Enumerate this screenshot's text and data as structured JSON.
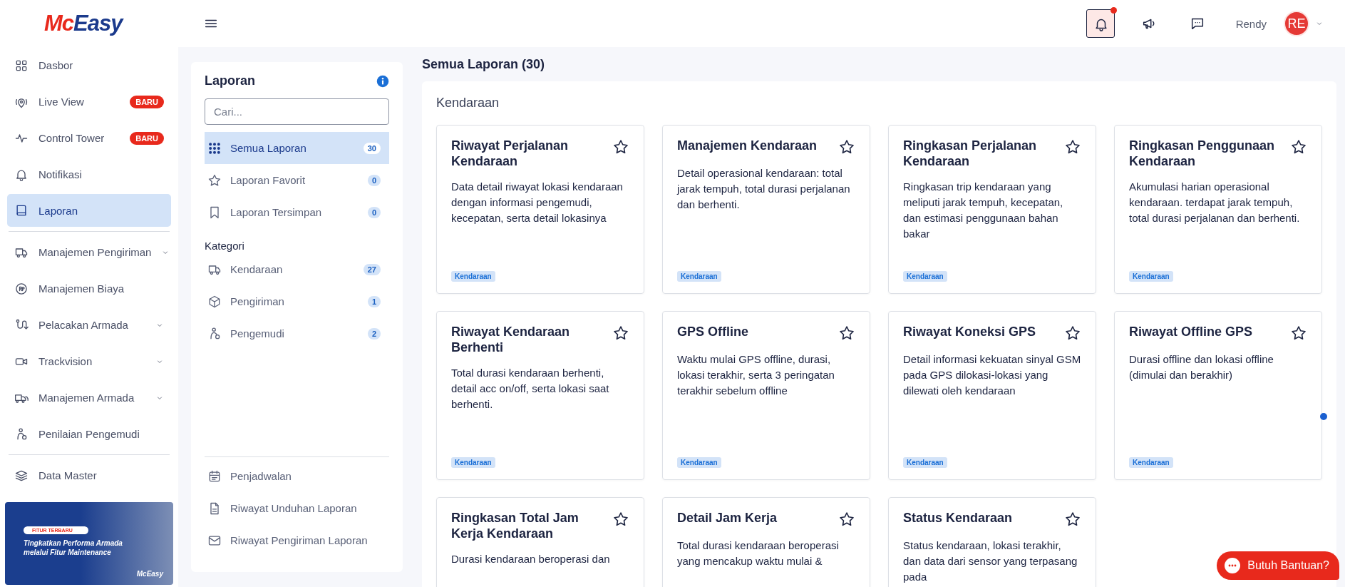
{
  "header": {
    "logo": [
      "Mc",
      "Easy"
    ],
    "notifications_unread": true,
    "user_name": "Rendy",
    "avatar_initials": "RE"
  },
  "sidebar": {
    "sections": [
      [
        {
          "label": "Dasbor",
          "selected": false,
          "expandable": false
        },
        {
          "label": "Live View",
          "badge": "BARU",
          "selected": false,
          "expandable": false
        },
        {
          "label": "Control Tower",
          "badge": "BARU",
          "selected": false,
          "expandable": false
        },
        {
          "label": "Notifikasi",
          "selected": false,
          "expandable": false
        },
        {
          "label": "Laporan",
          "selected": true,
          "expandable": false
        }
      ],
      [
        {
          "label": "Manajemen Pengiriman",
          "selected": false,
          "expandable": true
        },
        {
          "label": "Manajemen Biaya",
          "selected": false,
          "expandable": false
        },
        {
          "label": "Pelacakan Armada",
          "selected": false,
          "expandable": true
        },
        {
          "label": "Trackvision",
          "selected": false,
          "expandable": true
        },
        {
          "label": "Manajemen Armada",
          "selected": false,
          "expandable": true
        },
        {
          "label": "Penilaian Pengemudi",
          "selected": false,
          "expandable": false
        }
      ],
      [
        {
          "label": "Data Master",
          "selected": false,
          "expandable": false
        }
      ]
    ],
    "promo": {
      "tag": "FITUR TERBARU",
      "text": "Tingkatkan Performa Armada melalui Fitur Maintenance",
      "brand": "McEasy"
    }
  },
  "report_panel": {
    "title": "Laporan",
    "search": {
      "placeholder": "Cari..."
    },
    "filters": [
      {
        "label": "Semua Laporan",
        "count": "30",
        "selected": true
      },
      {
        "label": "Laporan Favorit",
        "count": "0",
        "selected": false
      },
      {
        "label": "Laporan Tersimpan",
        "count": "0",
        "selected": false
      }
    ],
    "category_heading": "Kategori",
    "categories": [
      {
        "label": "Kendaraan",
        "count": "27",
        "selected": false
      },
      {
        "label": "Pengiriman",
        "count": "1",
        "selected": false
      },
      {
        "label": "Pengemudi",
        "count": "2",
        "selected": false
      }
    ],
    "links": [
      "Penjadwalan",
      "Riwayat Unduhan Laporan",
      "Riwayat Pengiriman Laporan"
    ]
  },
  "main": {
    "heading": "Semua Laporan (30)",
    "section_title": "Kendaraan",
    "cards": [
      {
        "title": "Riwayat Perjalanan Kendaraan",
        "description": "Data detail riwayat lokasi kendaraan dengan informasi pengemudi, kecepatan, serta detail lokasinya",
        "tag": "Kendaraan",
        "favorite": false
      },
      {
        "title": "Manajemen Kendaraan",
        "description": "Detail operasional kendaraan: total jarak tempuh, total durasi perjalanan dan berhenti.",
        "tag": "Kendaraan",
        "favorite": false
      },
      {
        "title": "Ringkasan Perjalanan Kendaraan",
        "description": "Ringkasan trip kendaraan yang meliputi jarak tempuh, kecepatan, dan estimasi penggunaan bahan bakar",
        "tag": "Kendaraan",
        "favorite": false
      },
      {
        "title": "Ringkasan Penggunaan Kendaraan",
        "description": "Akumulasi harian operasional kendaraan. terdapat jarak tempuh, total durasi perjalanan dan berhenti.",
        "tag": "Kendaraan",
        "favorite": false
      },
      {
        "title": "Riwayat Kendaraan Berhenti",
        "description": "Total durasi kendaraan berhenti, detail acc on/off, serta lokasi saat berhenti.",
        "tag": "Kendaraan",
        "favorite": false
      },
      {
        "title": "GPS Offline",
        "description": "Waktu mulai GPS offline, durasi, lokasi terakhir, serta 3 peringatan terakhir sebelum offline",
        "tag": "Kendaraan",
        "favorite": false
      },
      {
        "title": "Riwayat Koneksi GPS",
        "description": "Detail informasi kekuatan sinyal GSM pada GPS dilokasi-lokasi yang dilewati oleh kendaraan",
        "tag": "Kendaraan",
        "favorite": false
      },
      {
        "title": "Riwayat Offline GPS",
        "description": "Durasi offline dan lokasi offline (dimulai dan berakhir)",
        "tag": "Kendaraan",
        "favorite": false
      },
      {
        "title": "Ringkasan Total Jam Kerja Kendaraan",
        "description": "Durasi kendaraan beroperasi dan",
        "favorite": false
      },
      {
        "title": "Detail Jam Kerja",
        "description": "Total durasi kendaraan beroperasi yang mencakup waktu mulai &",
        "favorite": false
      },
      {
        "title": "Status Kendaraan",
        "description": "Status kendaraan, lokasi terakhir, dan data dari sensor yang terpasang pada",
        "favorite": false
      }
    ]
  },
  "help_button": "Butuh Bantuan?"
}
